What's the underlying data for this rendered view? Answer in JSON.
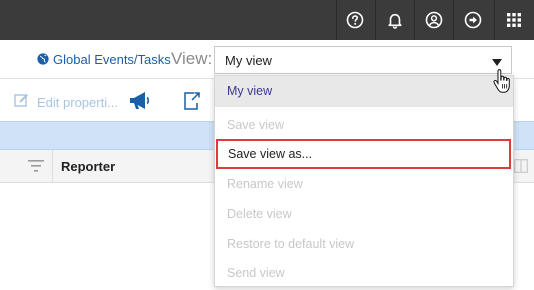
{
  "topbar": {
    "icons": [
      "help-icon",
      "bell-icon",
      "user-icon",
      "logout-icon",
      "apps-grid-icon"
    ]
  },
  "header": {
    "breadcrumb": "Global Events/Tasks",
    "view_label": "View:",
    "view_selected": "My view"
  },
  "toolbar": {
    "edit_label": "Edit properti..."
  },
  "table": {
    "columns": [
      "Reporter"
    ]
  },
  "dropdown": {
    "items": [
      {
        "label": "My view",
        "state": "selected"
      },
      {
        "label": "Save view",
        "state": "disabled"
      },
      {
        "label": "Save view as...",
        "state": "enabled"
      },
      {
        "label": "Rename view",
        "state": "disabled"
      },
      {
        "label": "Delete view",
        "state": "disabled"
      },
      {
        "label": "Restore to default view",
        "state": "disabled"
      },
      {
        "label": "Send view",
        "state": "disabled"
      }
    ]
  },
  "colors": {
    "topbar": "#3b3b3b",
    "link": "#1a5fa8",
    "band": "#cfe2f7",
    "highlight": "#e0393e"
  }
}
